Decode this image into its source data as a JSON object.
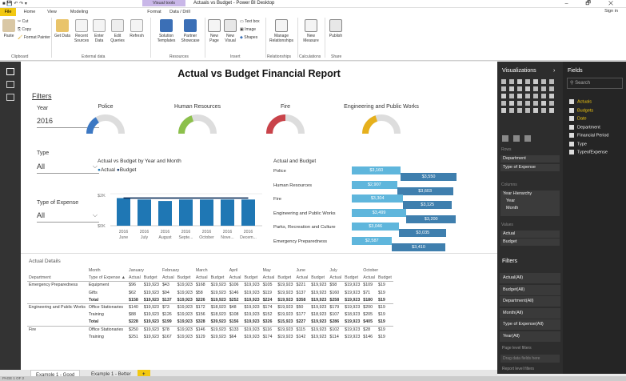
{
  "window": {
    "title": "Actuals vs Budget - Power BI Desktop",
    "context_tab": "Visual tools",
    "signin": "Sign in",
    "controls": "– 🗗 ✕"
  },
  "menu_tabs": [
    "File",
    "Home",
    "View",
    "Modeling",
    "Format",
    "Data / Drill"
  ],
  "ribbon": {
    "clipboard": {
      "cut": "Cut",
      "copy": "Copy",
      "paste": "Paste",
      "format_painter": "Format Painter",
      "group": "Clipboard"
    },
    "external": {
      "get_data": "Get Data",
      "recent": "Recent Sources",
      "enter": "Enter Data",
      "edit": "Edit Queries",
      "refresh": "Refresh",
      "group": "External data"
    },
    "resources": {
      "solution": "Solution Templates",
      "partner": "Partner Showcase",
      "group": "Resources"
    },
    "insert": {
      "new_page": "New Page",
      "new_visual": "New Visual",
      "text_box": "Text box",
      "image": "Image",
      "shapes": "Shapes",
      "group": "Insert"
    },
    "relationships": {
      "manage": "Manage Relationships",
      "group": "Relationships"
    },
    "calculations": {
      "new_measure": "New Measure",
      "group": "Calculations"
    },
    "share": {
      "publish": "Publish",
      "group": "Share"
    }
  },
  "report": {
    "title": "Actual vs Budget Financial Report",
    "filters_label": "Filters",
    "year_label": "Year",
    "year_value": "2016",
    "type_label": "Type",
    "type_value": "All",
    "expense_label": "Type of Expense",
    "expense_value": "All"
  },
  "gauges": [
    {
      "name": "Police",
      "value": 0.33,
      "color": "#3c78c3"
    },
    {
      "name": "Human Resources",
      "value": 0.4,
      "color": "#8cc04b"
    },
    {
      "name": "Fire",
      "value": 0.5,
      "color": "#c9434a"
    },
    {
      "name": "Engineering and Public Works",
      "value": 0.4,
      "color": "#e6b01c"
    }
  ],
  "combo": {
    "title": "Actual vs Budget by Year and Month",
    "legend_actual": "Actual",
    "legend_budget": "Budget",
    "y_ticks": [
      "$2K",
      "$0K"
    ],
    "categories": [
      "2016 June",
      "2016 July",
      "2016 August",
      "2016 Septe...",
      "2016 October",
      "2016 Nove...",
      "2016 Decem..."
    ]
  },
  "hbar": {
    "title": "Actual and Budget",
    "rows": [
      {
        "label": "Police",
        "actual": "$3,160",
        "budget": "$3,550"
      },
      {
        "label": "Human Resources",
        "actual": "$2,907",
        "budget": "$3,603"
      },
      {
        "label": "Fire",
        "actual": "$3,304",
        "budget": "$3,125"
      },
      {
        "label": "Engineering and Public Works",
        "actual": "$3,499",
        "budget": "$3,200"
      },
      {
        "label": "Parks, Recreation and Culture",
        "actual": "$3,046",
        "budget": "$3,035"
      },
      {
        "label": "Emergency Preparedness",
        "actual": "$2,587",
        "budget": "$3,410"
      }
    ]
  },
  "chart_data": [
    {
      "type": "bar",
      "title": "Actual vs Budget by Year and Month",
      "series": [
        {
          "name": "Actual",
          "values": [
            1.9,
            1.8,
            1.7,
            1.8,
            1.8,
            1.8,
            1.8
          ]
        },
        {
          "name": "Budget",
          "values": [
            1.9,
            1.9,
            1.9,
            1.9,
            1.9,
            1.9,
            1.9
          ]
        }
      ],
      "categories": [
        "2016 June",
        "2016 July",
        "2016 August",
        "2016 Septe...",
        "2016 October",
        "2016 Nove...",
        "2016 Decem..."
      ],
      "ylabel": "",
      "y_ticks": [
        "$0K",
        "$2K"
      ]
    },
    {
      "type": "bar",
      "title": "Actual and Budget",
      "categories": [
        "Police",
        "Human Resources",
        "Fire",
        "Engineering and Public Works",
        "Parks, Recreation and Culture",
        "Emergency Preparedness"
      ],
      "series": [
        {
          "name": "Actual",
          "values": [
            3160,
            2907,
            3304,
            3499,
            3046,
            2587
          ]
        },
        {
          "name": "Budget",
          "values": [
            3550,
            3603,
            3125,
            3200,
            3035,
            3410
          ]
        }
      ]
    }
  ],
  "details": {
    "title": "Actual Details",
    "months": [
      "January",
      "February",
      "March",
      "April",
      "May",
      "June",
      "July",
      "October"
    ],
    "col_dept": "Department",
    "col_month": "Month",
    "col_type": "Type of Expense ▲",
    "actual": "Actual",
    "budget": "Budget",
    "rows": [
      [
        "Emergency Preparedness",
        "Equipment",
        "$96",
        "$19,923",
        "$43",
        "$19,923",
        "$168",
        "$19,923",
        "$106",
        "$19,923",
        "$105",
        "$19,923",
        "$221",
        "$19,923",
        "$58",
        "$19,923",
        "$109",
        "$19"
      ],
      [
        "",
        "Gifts",
        "$62",
        "$19,923",
        "$94",
        "$19,923",
        "$58",
        "$19,923",
        "$146",
        "$19,923",
        "$119",
        "$19,923",
        "$137",
        "$19,923",
        "$160",
        "$19,923",
        "$71",
        "$19"
      ],
      [
        "",
        "Total",
        "$158",
        "$19,923",
        "$137",
        "$19,923",
        "$226",
        "$19,923",
        "$252",
        "$19,923",
        "$224",
        "$19,923",
        "$358",
        "$19,923",
        "$258",
        "$19,923",
        "$180",
        "$19"
      ],
      [
        "Engineering and Public Works",
        "Office Stationaries",
        "$140",
        "$19,923",
        "$73",
        "$19,923",
        "$172",
        "$18,923",
        "$48",
        "$19,923",
        "$174",
        "$19,923",
        "$50",
        "$19,923",
        "$179",
        "$19,923",
        "$200",
        "$19"
      ],
      [
        "",
        "Training",
        "$88",
        "$19,923",
        "$126",
        "$19,923",
        "$156",
        "$18,923",
        "$108",
        "$19,923",
        "$152",
        "$19,923",
        "$177",
        "$18,923",
        "$107",
        "$18,923",
        "$205",
        "$19"
      ],
      [
        "",
        "Total",
        "$228",
        "$19,923",
        "$199",
        "$19,923",
        "$328",
        "$39,923",
        "$156",
        "$19,923",
        "$326",
        "$15,923",
        "$227",
        "$19,923",
        "$286",
        "$19,923",
        "$405",
        "$19"
      ],
      [
        "Fire",
        "Office Stationaries",
        "$250",
        "$19,923",
        "$78",
        "$19,923",
        "$146",
        "$19,923",
        "$133",
        "$19,923",
        "$116",
        "$19,923",
        "$115",
        "$19,923",
        "$102",
        "$19,923",
        "$28",
        "$19"
      ],
      [
        "",
        "Training",
        "$251",
        "$19,923",
        "$167",
        "$19,923",
        "$129",
        "$19,923",
        "$64",
        "$19,923",
        "$174",
        "$19,923",
        "$142",
        "$19,923",
        "$114",
        "$19,923",
        "$146",
        "$19"
      ]
    ]
  },
  "viz_panel": {
    "title": "Visualizations",
    "rows": "Rows",
    "rows_items": [
      "Department",
      "Type of Expense"
    ],
    "columns": "Columns",
    "col_items": [
      "Year Hierarchy",
      "Year",
      "Month"
    ],
    "values": "Values",
    "val_items": [
      "Actual",
      "Budget"
    ],
    "filters": "Filters",
    "filter_items": [
      "Actual(All)",
      "Budget(All)",
      "Department(All)",
      "Month(All)",
      "Type of Expense(All)",
      "Year(All)"
    ],
    "page_filters": "Page level filters",
    "drag": "Drag data fields here",
    "report_filters": "Report level filters"
  },
  "fields_panel": {
    "title": "Fields",
    "search": "Search",
    "items": [
      {
        "name": "Actuals",
        "hl": true
      },
      {
        "name": "Budgets",
        "hl": true
      },
      {
        "name": "Date",
        "hl": true
      },
      {
        "name": "Department",
        "hl": false
      },
      {
        "name": "Financial Period",
        "hl": false
      },
      {
        "name": "Type",
        "hl": false
      },
      {
        "name": "TypeofExpense",
        "hl": false
      }
    ]
  },
  "pages": [
    "Example 1 - Good",
    "Example 1 - Better",
    "+"
  ],
  "status": "PAGE 1 OF 2"
}
